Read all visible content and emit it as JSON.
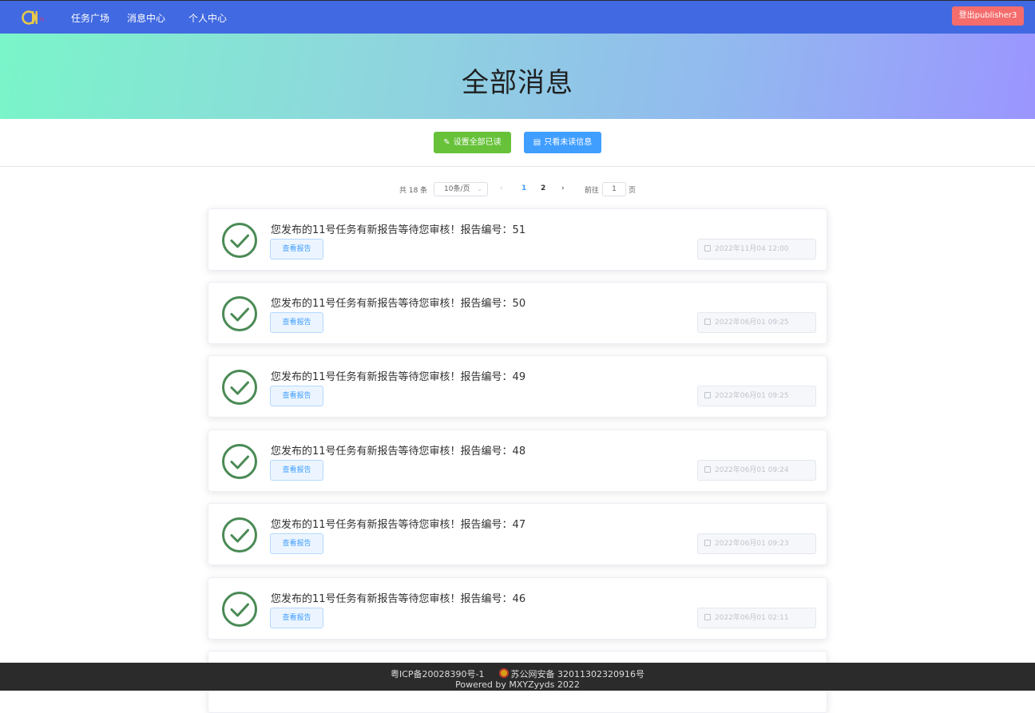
{
  "nav": {
    "logo_icon": "app-logo",
    "items": [
      {
        "label": "任务广场"
      },
      {
        "label": "消息中心"
      },
      {
        "label": "个人中心"
      }
    ],
    "logout_label": "登出publisher3"
  },
  "hero": {
    "title": "全部消息"
  },
  "actions": {
    "mark_all_read": {
      "label": "设置全部已读",
      "icon": "edit-icon"
    },
    "unread_only": {
      "label": "只看未读信息",
      "icon": "document-icon"
    }
  },
  "pagination": {
    "total": "共 18 条",
    "page_size": "10条/页",
    "pages": [
      "1",
      "2"
    ],
    "current_page": "1",
    "goto_label": "前往",
    "goto_value": "1",
    "page_suffix": "页"
  },
  "messages": [
    {
      "text": "您发布的11号任务有新报告等待您审核！报告编号：51",
      "button": "查看报告",
      "time": "2022年11月04 12:00"
    },
    {
      "text": "您发布的11号任务有新报告等待您审核！报告编号：50",
      "button": "查看报告",
      "time": "2022年06月01 09:25"
    },
    {
      "text": "您发布的11号任务有新报告等待您审核！报告编号：49",
      "button": "查看报告",
      "time": "2022年06月01 09:25"
    },
    {
      "text": "您发布的11号任务有新报告等待您审核！报告编号：48",
      "button": "查看报告",
      "time": "2022年06月01 09:24"
    },
    {
      "text": "您发布的11号任务有新报告等待您审核！报告编号：47",
      "button": "查看报告",
      "time": "2022年06月01 09:23"
    },
    {
      "text": "您发布的11号任务有新报告等待您审核！报告编号：46",
      "button": "查看报告",
      "time": "2022年06月01 02:11"
    }
  ],
  "footer": {
    "icp": "粤ICP备20028390号-1",
    "police": "苏公网安备 32011302320916号",
    "powered": "Powered by MXYZyyds 2022"
  },
  "colors": {
    "nav_bg": "#4169e1",
    "logout": "#f56c6c",
    "green_btn": "#67c23a",
    "blue_btn": "#409eff",
    "check": "#4a8a55"
  }
}
